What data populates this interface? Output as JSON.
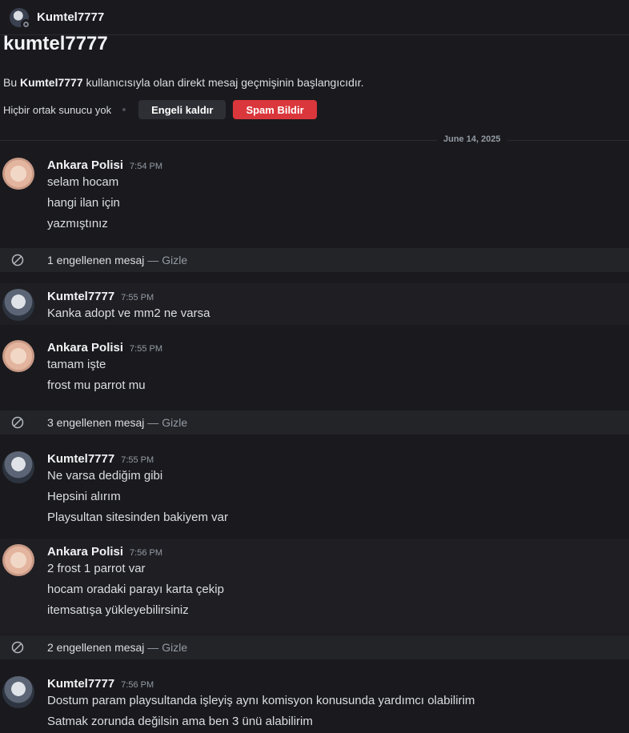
{
  "header": {
    "username": "Kumtel7777"
  },
  "intro": {
    "title": "kumtel7777",
    "desc_prefix": "Bu ",
    "desc_name": "Kumtel7777",
    "desc_suffix": " kullanıcısıyla olan direkt mesaj geçmişinin başlangıcıdır.",
    "mutual": "Hiçbir ortak sunucu yok",
    "unblock_label": "Engeli kaldır",
    "spam_label": "Spam Bildir"
  },
  "date_divider": "June 14, 2025",
  "messages": [
    {
      "author": "Ankara Polisi",
      "time": "7:54 PM",
      "lines": [
        "selam hocam",
        "hangi ilan için",
        "yazmıştınız"
      ]
    },
    {
      "author": "Kumtel7777",
      "time": "7:55 PM",
      "lines": [
        "Kanka adopt ve mm2 ne varsa"
      ]
    },
    {
      "author": "Ankara Polisi",
      "time": "7:55 PM",
      "lines": [
        "tamam işte",
        "frost mu parrot mu"
      ]
    },
    {
      "author": "Kumtel7777",
      "time": "7:55 PM",
      "lines": [
        "Ne varsa dediğim gibi",
        "Hepsini alırım",
        "Playsultan sitesinden bakiyem var"
      ]
    },
    {
      "author": "Ankara Polisi",
      "time": "7:56 PM",
      "lines": [
        "2 frost 1 parrot var",
        "hocam oradaki parayı karta çekip",
        "itemsatışa yükleyebilirsiniz"
      ]
    },
    {
      "author": "Kumtel7777",
      "time": "7:56 PM",
      "lines": [
        "Dostum param playsultanda işleyiş aynı komisyon konusunda yardımcı olabilirim",
        "Satmak zorunda değilsin ama ben 3 ünü alabilirim"
      ]
    }
  ],
  "blocked": [
    {
      "count_text": "1 engellenen mesaj",
      "sep": " — ",
      "action": "Gizle"
    },
    {
      "count_text": "3 engellenen mesaj",
      "sep": " — ",
      "action": "Gizle"
    },
    {
      "count_text": "2 engellenen mesaj",
      "sep": " — ",
      "action": "Gizle"
    }
  ]
}
